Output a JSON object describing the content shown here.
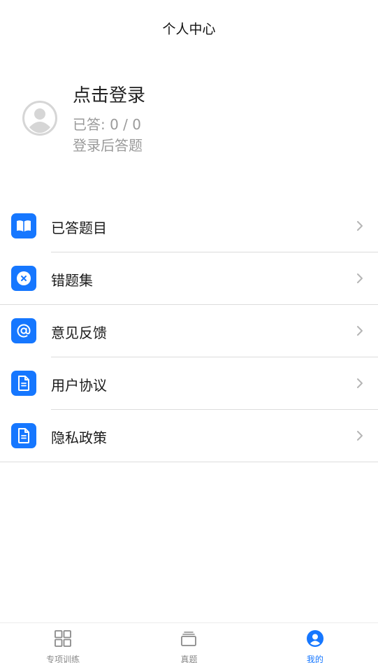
{
  "header": {
    "title": "个人中心"
  },
  "profile": {
    "login_label": "点击登录",
    "answered_label": "已答: 0 / 0",
    "hint_label": "登录后答题"
  },
  "menu": {
    "items": [
      {
        "label": "已答题目",
        "icon": "book-icon"
      },
      {
        "label": "错题集",
        "icon": "wrong-icon"
      },
      {
        "label": "意见反馈",
        "icon": "at-icon"
      },
      {
        "label": "用户协议",
        "icon": "document-icon"
      },
      {
        "label": "隐私政策",
        "icon": "document-icon"
      }
    ]
  },
  "tabbar": {
    "tabs": [
      {
        "label": "专项训练",
        "icon": "grid-icon",
        "active": false
      },
      {
        "label": "真题",
        "icon": "stack-icon",
        "active": false
      },
      {
        "label": "我的",
        "icon": "user-icon",
        "active": true
      }
    ]
  },
  "colors": {
    "accent": "#1677ff",
    "muted_text": "#9a9a9a",
    "divider": "#dcdcdc"
  }
}
